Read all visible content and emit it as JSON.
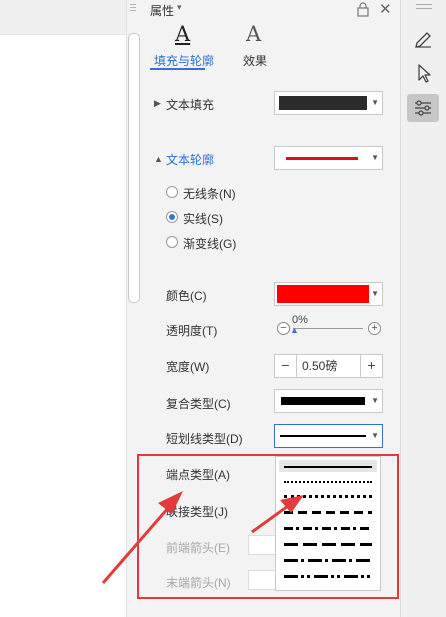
{
  "header": {
    "title": "属性"
  },
  "tabs": [
    {
      "label": "填充与轮廓",
      "icon": "A"
    },
    {
      "label": "效果",
      "icon": "A"
    }
  ],
  "text_fill": {
    "label": "文本填充",
    "color": "#2b2b2b"
  },
  "text_outline": {
    "label": "文本轮廓",
    "line_color": "#e01010",
    "options": [
      {
        "label": "无线条(N)",
        "underline_char": "N"
      },
      {
        "label": "实线(S)",
        "underline_char": "S"
      },
      {
        "label": "渐变线(G)",
        "underline_char": "G"
      }
    ],
    "selected": 1
  },
  "color_row": {
    "label": "颜色(C)",
    "value": "#ff0000"
  },
  "transparency": {
    "label": "透明度(T)",
    "value": "0%"
  },
  "width_row": {
    "label": "宽度(W)",
    "value": "0.50磅",
    "minus": "−",
    "plus": "+"
  },
  "compound_type": {
    "label": "复合类型(C)"
  },
  "dash_type": {
    "label": "短划线类型(D)"
  },
  "cap_type": {
    "label": "端点类型(A)"
  },
  "join_type": {
    "label": "联接类型(J)"
  },
  "begin_arrow": {
    "label": "前端箭头(E)"
  },
  "end_arrow": {
    "label": "末端箭头(N)"
  },
  "dash_options": [
    "solid",
    "round-dot",
    "square-dot",
    "dash",
    "dash-dot",
    "long-dash",
    "long-dash-dot",
    "long-dash-dot-dot"
  ],
  "toolbar": {
    "icons": [
      "pen-icon",
      "pointer-icon",
      "settings-sliders-icon"
    ]
  },
  "colors": {
    "accent": "#3a6fd8",
    "annotation": "#e23b3b"
  }
}
